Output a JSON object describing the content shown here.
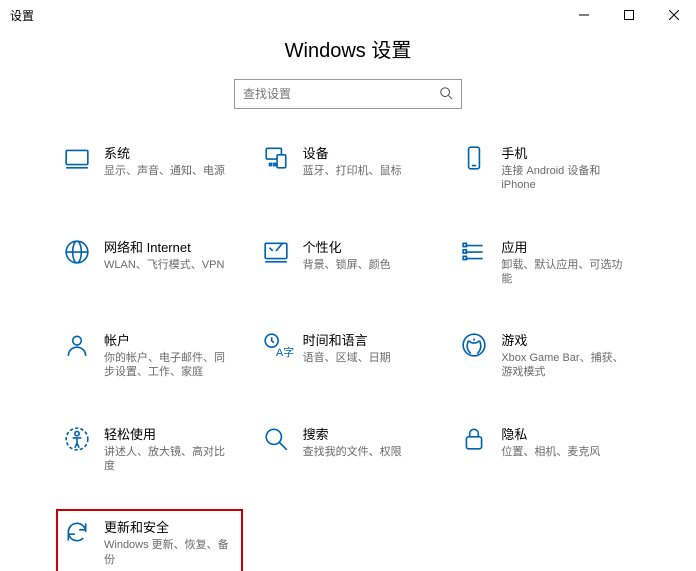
{
  "window": {
    "title": "设置"
  },
  "page": {
    "heading": "Windows 设置"
  },
  "search": {
    "placeholder": "查找设置"
  },
  "tiles": [
    {
      "key": "system",
      "title": "系统",
      "desc": "显示、声音、通知、电源"
    },
    {
      "key": "devices",
      "title": "设备",
      "desc": "蓝牙、打印机、鼠标"
    },
    {
      "key": "phone",
      "title": "手机",
      "desc": "连接 Android 设备和 iPhone"
    },
    {
      "key": "network",
      "title": "网络和 Internet",
      "desc": "WLAN、飞行模式、VPN"
    },
    {
      "key": "personal",
      "title": "个性化",
      "desc": "背景、锁屏、颜色"
    },
    {
      "key": "apps",
      "title": "应用",
      "desc": "卸载、默认应用、可选功能"
    },
    {
      "key": "accounts",
      "title": "帐户",
      "desc": "你的帐户、电子邮件、同步设置、工作、家庭"
    },
    {
      "key": "time",
      "title": "时间和语言",
      "desc": "语音、区域、日期"
    },
    {
      "key": "gaming",
      "title": "游戏",
      "desc": "Xbox Game Bar、捕获、游戏模式"
    },
    {
      "key": "ease",
      "title": "轻松使用",
      "desc": "讲述人、放大镜、高对比度"
    },
    {
      "key": "searchc",
      "title": "搜索",
      "desc": "查找我的文件、权限"
    },
    {
      "key": "privacy",
      "title": "隐私",
      "desc": "位置、相机、麦克风"
    },
    {
      "key": "update",
      "title": "更新和安全",
      "desc": "Windows 更新、恢复、备份"
    }
  ]
}
